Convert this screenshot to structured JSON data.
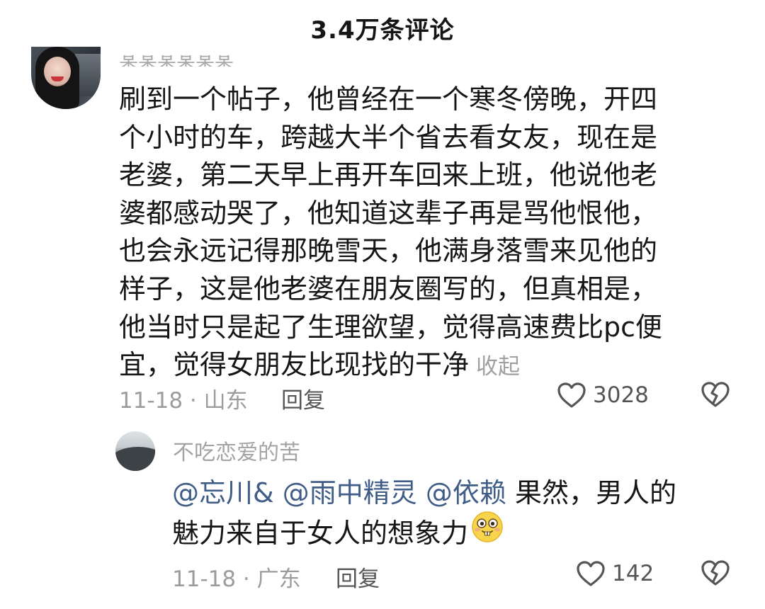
{
  "header": {
    "title": "3.4万条评论"
  },
  "colors": {
    "background": "#ffffff",
    "text": "#161616",
    "muted": "#9c9c9c",
    "mention": "#3f5d86",
    "icon": "#555555"
  },
  "comment": {
    "lines": [
      "刷到一个帖子，他曾经在一个寒冬傍晚，开四",
      "个小时的车，跨越大半个省去看女友，现在是",
      "老婆，第二天早上再开车回来上班，他说他老",
      "婆都感动哭了，他知道这辈子再是骂他恨他，",
      "也会永远记得那晚雪天，他满身落雪来见他的",
      "样子，这是他老婆在朋友圈写的，但真相是，",
      "他当时只是起了生理欲望，觉得高速费比pc便",
      "宜，觉得女朋友比现找的干净"
    ],
    "collapse_label": "收起",
    "date_location": "11-18 · 山东",
    "reply_label": "回复",
    "like_count": "3028",
    "like_icon": "heart-outline-icon",
    "dislike_icon": "broken-heart-icon"
  },
  "reply": {
    "author": "不吃恋爱的苦",
    "mentions": [
      "@忘川&",
      "@雨中精灵",
      "@依赖"
    ],
    "text_line1": "果然，男人的",
    "text_line2": "魅力来自于女人的想象力",
    "emoji_icon": "buck-teeth-smile-emoji",
    "date_location": "11-18 · 广东",
    "reply_label": "回复",
    "like_count": "142",
    "like_icon": "heart-outline-icon",
    "dislike_icon": "broken-heart-icon"
  }
}
